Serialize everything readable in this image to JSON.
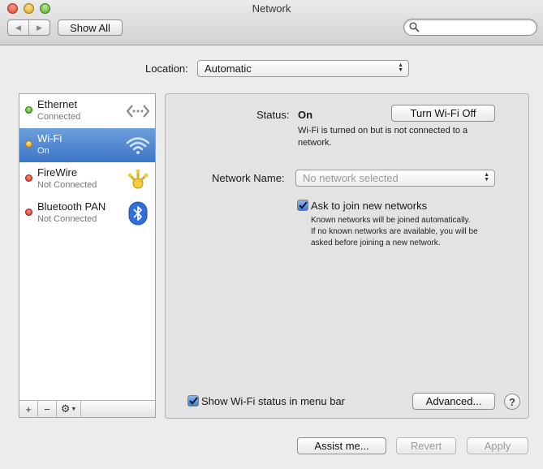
{
  "window": {
    "title": "Network"
  },
  "toolbar": {
    "show_all_label": "Show All",
    "search_placeholder": ""
  },
  "location": {
    "label": "Location:",
    "value": "Automatic"
  },
  "services": [
    {
      "name": "Ethernet",
      "status": "Connected",
      "status_color": "#3a9a1e",
      "icon": "ethernet-icon"
    },
    {
      "name": "Wi-Fi",
      "status": "On",
      "status_color": "#d79b15",
      "icon": "wifi-icon",
      "selected": true
    },
    {
      "name": "FireWire",
      "status": "Not Connected",
      "status_color": "#d22b1b",
      "icon": "firewire-icon"
    },
    {
      "name": "Bluetooth PAN",
      "status": "Not Connected",
      "status_color": "#d22b1b",
      "icon": "bluetooth-icon"
    }
  ],
  "sidebar_controls": {
    "add": "+",
    "remove": "−"
  },
  "detail": {
    "status_label": "Status:",
    "status_value": "On",
    "turn_off_label": "Turn Wi-Fi Off",
    "status_desc_1": "Wi-Fi is turned on but is not connected to a",
    "status_desc_2": "network.",
    "network_name_label": "Network Name:",
    "network_name_value": "No network selected",
    "ask_join_label": "Ask to join new networks",
    "ask_join_checked": true,
    "ask_desc_1": "Known networks will be joined automatically.",
    "ask_desc_2": "If no known networks are available, you will be",
    "ask_desc_3": "asked before joining a new network.",
    "show_status_label": "Show Wi-Fi status in menu bar",
    "show_status_checked": true,
    "advanced_label": "Advanced...",
    "help_label": "?"
  },
  "footer": {
    "assist_label": "Assist me...",
    "revert_label": "Revert",
    "apply_label": "Apply"
  },
  "colors": {
    "selection": "#3c76c6",
    "checkbox": "#3f7ad1"
  }
}
